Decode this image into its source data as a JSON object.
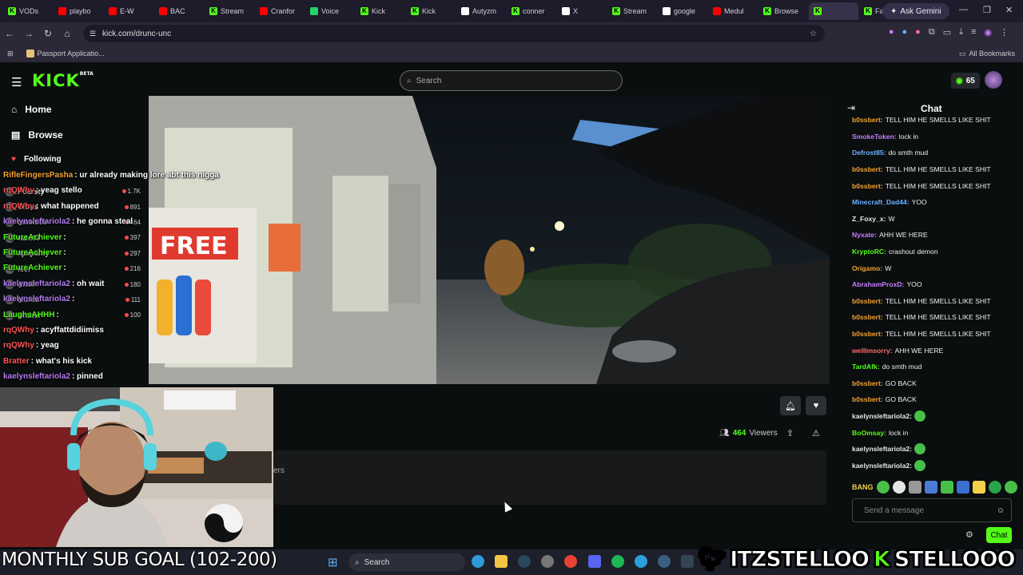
{
  "browser": {
    "tabs": [
      {
        "label": "VODs",
        "icon": "kick-icon",
        "color": "#53fc18"
      },
      {
        "label": "playbo",
        "icon": "youtube-icon",
        "color": "#ff0000"
      },
      {
        "label": "E-W",
        "icon": "youtube-icon",
        "color": "#ff0000"
      },
      {
        "label": "BAC",
        "icon": "youtube-icon",
        "color": "#ff0000"
      },
      {
        "label": "Stream",
        "icon": "kick-icon",
        "color": "#53fc18"
      },
      {
        "label": "Cranfor",
        "icon": "youtube-icon",
        "color": "#ff0000"
      },
      {
        "label": "Voice",
        "icon": "whatsapp-icon",
        "color": "#25d366"
      },
      {
        "label": "Kick",
        "icon": "kick-icon",
        "color": "#53fc18"
      },
      {
        "label": "Kick",
        "icon": "kick-icon",
        "color": "#53fc18"
      },
      {
        "label": "Autyzm",
        "icon": "google-icon",
        "color": "#ffffff"
      },
      {
        "label": "conner",
        "icon": "kick-icon",
        "color": "#53fc18"
      },
      {
        "label": "X",
        "icon": "x-icon",
        "color": "#ffffff"
      },
      {
        "label": "Stream",
        "icon": "kick-icon",
        "color": "#53fc18"
      },
      {
        "label": "google",
        "icon": "google-icon",
        "color": "#ffffff"
      },
      {
        "label": "Medul",
        "icon": "youtube-icon",
        "color": "#ff0000"
      },
      {
        "label": "Browse",
        "icon": "kick-icon",
        "color": "#53fc18"
      },
      {
        "label": "",
        "icon": "kick-icon",
        "color": "#53fc18",
        "active": true
      },
      {
        "label": "FastM",
        "icon": "kick-icon",
        "color": "#53fc18"
      }
    ],
    "ask_gemini": "Ask Gemini",
    "url": "kick.com/drunc-unc",
    "bookmark_passport": "Passport Applicatio...",
    "all_bookmarks": "All Bookmarks"
  },
  "kick": {
    "logo": "KICK",
    "logo_badge": "BETA",
    "search_placeholder": "Search",
    "points": "65",
    "nav": {
      "home": "Home",
      "browse": "Browse",
      "following": "Following"
    },
    "following": [
      {
        "name": "Poorsty",
        "viewers": "1.7K"
      },
      {
        "name": "Citrus",
        "viewers": "891"
      },
      {
        "name": "tomxbcc",
        "viewers": "464"
      },
      {
        "name": "razo97",
        "viewers": "397"
      },
      {
        "name": "xpxpanty",
        "viewers": "297"
      },
      {
        "name": "feef",
        "viewers": "216"
      },
      {
        "name": "Anvil",
        "viewers": "180"
      },
      {
        "name": "Murda",
        "viewers": "111"
      },
      {
        "name": "Bratter",
        "viewers": "100"
      }
    ],
    "viewers": "464",
    "viewers_label": "Viewers",
    "followers_partial": "ers"
  },
  "overlay_chat": [
    {
      "user": "RifleFingersPasha",
      "text": "ur already making lore abt this nigga",
      "color": "#f3a32f"
    },
    {
      "user": "rqQWhy",
      "text": "yeag stello",
      "color": "#ff5555"
    },
    {
      "user": "rqQWhy",
      "text": "what happened",
      "color": "#ff5555"
    },
    {
      "user": "kaelynslefta​riola2",
      "text": "he gonna steal",
      "color": "#b57cf0"
    },
    {
      "user": "FutureAchiever",
      "text": "",
      "color": "#53fc18"
    },
    {
      "user": "FutureAchiever",
      "text": "",
      "color": "#53fc18"
    },
    {
      "user": "FutureAchiever",
      "text": "",
      "color": "#53fc18"
    },
    {
      "user": "kaelynsleftariola2",
      "text": "oh wait",
      "color": "#b57cf0"
    },
    {
      "user": "kaelynsleftariola2",
      "text": "",
      "color": "#b57cf0"
    },
    {
      "user": "LaughsAHHH",
      "text": "",
      "color": "#53fc18"
    },
    {
      "user": "rqQWhy",
      "text": "acyffattdidiimiss",
      "color": "#ff5555"
    },
    {
      "user": "rqQWhy",
      "text": "yeag",
      "color": "#ff5555"
    },
    {
      "user": "Bratter",
      "text": "what's his kick",
      "color": "#ff5555"
    },
    {
      "user": "kaelynsleftariola2",
      "text": "pinned",
      "color": "#b57cf0"
    }
  ],
  "chat": {
    "title": "Chat",
    "input_placeholder": "Send a message",
    "send_label": "Chat",
    "messages": [
      {
        "user": "b0ssbert:",
        "text": "TELL HIM HE SMELLS LIKE SHIT",
        "color": "#f3a32f"
      },
      {
        "user": "SmokeToken:",
        "text": "lock in",
        "color": "#c77dff"
      },
      {
        "user": "Defrost85:",
        "text": "do smth mud",
        "color": "#6ab0ff"
      },
      {
        "user": "b0ssbert:",
        "text": "TELL HIM HE SMELLS LIKE SHIT",
        "color": "#f3a32f"
      },
      {
        "user": "b0ssbert:",
        "text": "TELL HIM HE SMELLS LIKE SHIT",
        "color": "#f3a32f"
      },
      {
        "user": "Minecraft_Dad44:",
        "text": "YOO",
        "color": "#6ab0ff"
      },
      {
        "user": "Z_Foxy_x:",
        "text": "W",
        "color": "#e6e6e6"
      },
      {
        "user": "Nyxate:",
        "text": "AHH WE HERE",
        "color": "#c77dff"
      },
      {
        "user": "KryptoRC:",
        "text": "crashout demon",
        "color": "#53fc18"
      },
      {
        "user": "Origamo:",
        "text": "W",
        "color": "#f3a32f"
      },
      {
        "user": "AbrahamProxD:",
        "text": "YOO",
        "color": "#c77dff"
      },
      {
        "user": "b0ssbert:",
        "text": "TELL HIM HE SMELLS LIKE SHIT",
        "color": "#f3a32f"
      },
      {
        "user": "b0ssbert:",
        "text": "TELL HIM HE SMELLS LIKE SHIT",
        "color": "#f3a32f"
      },
      {
        "user": "b0ssbert:",
        "text": "TELL HIM HE SMELLS LIKE SHIT",
        "color": "#f3a32f"
      },
      {
        "user": "wellImsorry:",
        "text": "AHH WE HERE",
        "color": "#ff6b6b"
      },
      {
        "user": "TardAfk:",
        "text": "do smth mud",
        "color": "#53fc18"
      },
      {
        "user": "b0ssbert:",
        "text": "GO BACK",
        "color": "#f3a32f"
      },
      {
        "user": "b0ssbert:",
        "text": "GO BACK",
        "color": "#f3a32f"
      },
      {
        "user": "kaelynsleftariola2:",
        "text": "",
        "color": "#e6e6e6",
        "emote": true
      },
      {
        "user": "BoOmsay:",
        "text": "lock in",
        "color": "#53fc18"
      },
      {
        "user": "kaelynsleftariola2:",
        "text": "",
        "color": "#e6e6e6",
        "emote": true
      },
      {
        "user": "kaelynsleftariola2:",
        "text": "",
        "color": "#e6e6e6",
        "emote": true
      }
    ],
    "emote_bar_label": "BANG"
  },
  "stream_overlay": {
    "sub_goal": "MONTHLY SUB GOAL (102-200)",
    "twitter_handle": "ITZSTELLOO",
    "kick_handle": "STELLOOO"
  },
  "taskbar": {
    "search_placeholder": "Search"
  }
}
